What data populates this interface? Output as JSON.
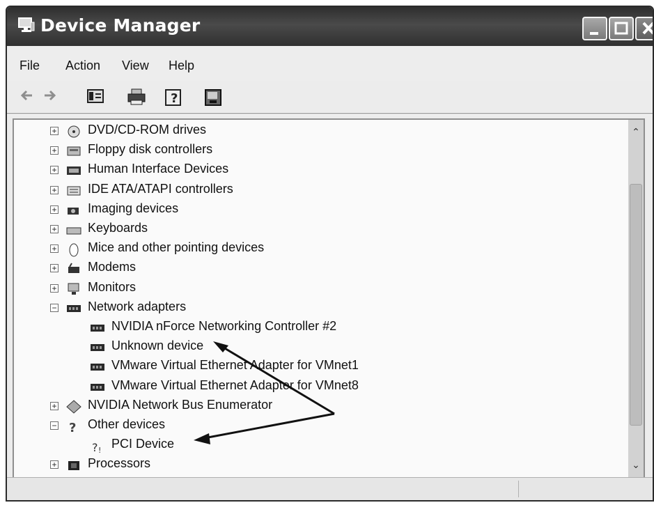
{
  "window": {
    "title": "Device Manager",
    "icons": {
      "app": "device-manager-icon",
      "minimize": "minimize-icon",
      "maximize": "maximize-icon",
      "close": "close-icon"
    }
  },
  "menu": [
    "File",
    "Action",
    "View",
    "Help"
  ],
  "toolbar": [
    {
      "name": "back-button",
      "icon": "back-arrow-icon"
    },
    {
      "name": "forward-button",
      "icon": "forward-arrow-icon"
    },
    {
      "name": "show-hide-console-tree-button",
      "icon": "console-tree-icon"
    },
    {
      "name": "print-button",
      "icon": "printer-icon"
    },
    {
      "name": "help-button",
      "icon": "help-icon"
    },
    {
      "name": "scan-hardware-button",
      "icon": "scan-hardware-icon"
    }
  ],
  "tree": {
    "items": [
      {
        "label": "DVD/CD-ROM drives",
        "level": 0,
        "expander": "+",
        "icon": "optical-drive-icon"
      },
      {
        "label": "Floppy disk controllers",
        "level": 0,
        "expander": "+",
        "icon": "floppy-controller-icon"
      },
      {
        "label": "Human Interface Devices",
        "level": 0,
        "expander": "+",
        "icon": "hid-icon"
      },
      {
        "label": "IDE ATA/ATAPI controllers",
        "level": 0,
        "expander": "+",
        "icon": "ide-controller-icon"
      },
      {
        "label": "Imaging devices",
        "level": 0,
        "expander": "+",
        "icon": "camera-icon"
      },
      {
        "label": "Keyboards",
        "level": 0,
        "expander": "+",
        "icon": "keyboard-icon"
      },
      {
        "label": "Mice and other pointing devices",
        "level": 0,
        "expander": "+",
        "icon": "mouse-icon"
      },
      {
        "label": "Modems",
        "level": 0,
        "expander": "+",
        "icon": "modem-icon"
      },
      {
        "label": "Monitors",
        "level": 0,
        "expander": "+",
        "icon": "monitor-icon"
      },
      {
        "label": "Network adapters",
        "level": 0,
        "expander": "−",
        "icon": "network-adapter-icon"
      },
      {
        "label": "NVIDIA nForce Networking Controller #2",
        "level": 1,
        "expander": "",
        "icon": "network-adapter-icon"
      },
      {
        "label": "Unknown device",
        "level": 1,
        "expander": "",
        "icon": "network-adapter-icon"
      },
      {
        "label": "VMware Virtual Ethernet Adapter for VMnet1",
        "level": 1,
        "expander": "",
        "icon": "network-adapter-icon"
      },
      {
        "label": "VMware Virtual Ethernet Adapter for VMnet8",
        "level": 1,
        "expander": "",
        "icon": "network-adapter-icon"
      },
      {
        "label": "NVIDIA Network Bus Enumerator",
        "level": 0,
        "expander": "+",
        "icon": "bus-enumerator-icon"
      },
      {
        "label": "Other devices",
        "level": 0,
        "expander": "−",
        "icon": "unknown-device-icon"
      },
      {
        "label": "PCI Device",
        "level": 1,
        "expander": "",
        "icon": "unknown-device-warning-icon"
      },
      {
        "label": "Processors",
        "level": 0,
        "expander": "+",
        "icon": "processor-icon"
      }
    ]
  },
  "colors": {
    "titlebar": "#3a3a3a",
    "window_bg": "#ececec",
    "tree_bg": "#fafafa"
  }
}
